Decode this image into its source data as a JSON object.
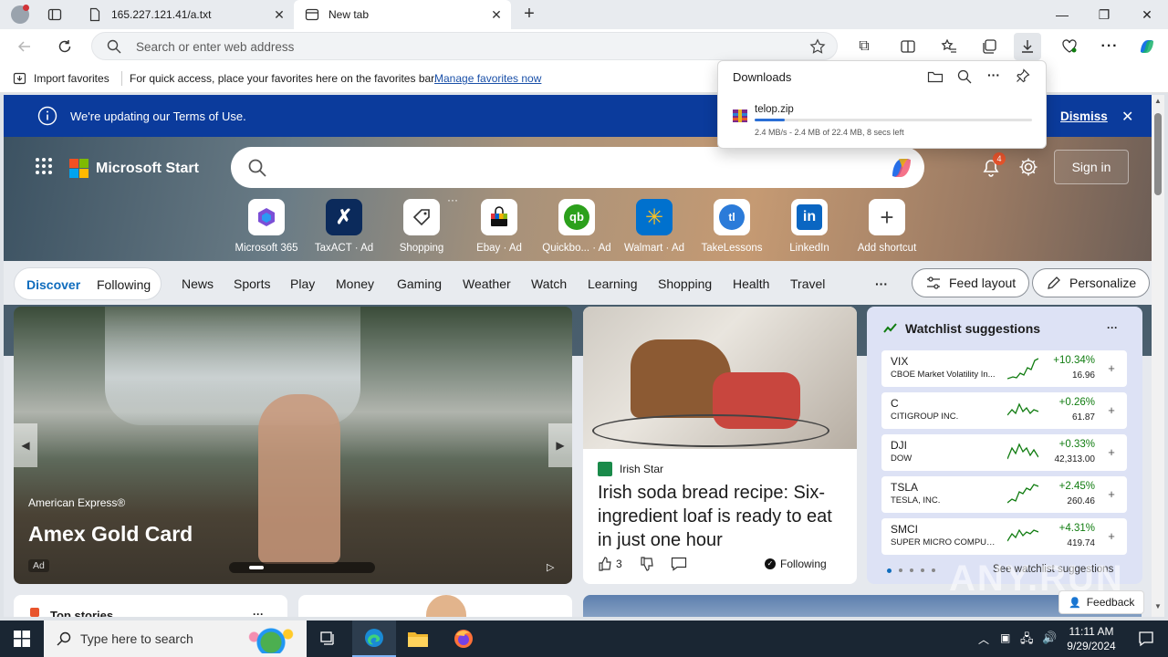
{
  "tabs": [
    {
      "label": "165.227.121.41/a.txt"
    },
    {
      "label": "New tab"
    }
  ],
  "omnibox": {
    "placeholder": "Search or enter web address"
  },
  "favbar": {
    "import_label": "Import favorites",
    "message": "For quick access, place your favorites here on the favorites bar.",
    "manage_link": "Manage favorites now"
  },
  "downloads": {
    "title": "Downloads",
    "file": "telop.zip",
    "status": "2.4 MB/s - 2.4 MB of 22.4 MB, 8 secs left",
    "progress": 0.107
  },
  "notice": {
    "text": "We're updating our Terms of Use.",
    "dismiss": "Dismiss"
  },
  "start": {
    "logo": "Microsoft Start",
    "notification_count": "4",
    "signin": "Sign in"
  },
  "shortcuts": [
    {
      "label": "Microsoft 365",
      "color": "#7b4fd6"
    },
    {
      "label": "TaxACT · Ad",
      "color": "#0b2a5b"
    },
    {
      "label": "Shopping",
      "color": "#444444"
    },
    {
      "label": "Ebay · Ad",
      "color": "#e53238"
    },
    {
      "label": "Quickbo... · Ad",
      "color": "#2ca01c"
    },
    {
      "label": "Walmart · Ad",
      "color": "#0071ce"
    },
    {
      "label": "TakeLessons",
      "color": "#2b7bd9"
    },
    {
      "label": "LinkedIn",
      "color": "#0a66c2"
    },
    {
      "label": "Add shortcut",
      "color": "#555555"
    }
  ],
  "feedtabs": {
    "discover": "Discover",
    "following": "Following",
    "items": [
      "News",
      "Sports",
      "Play",
      "Money",
      "Gaming",
      "Weather",
      "Watch",
      "Learning",
      "Shopping",
      "Health",
      "Travel"
    ],
    "more": "···",
    "feed_layout": "Feed layout",
    "personalize": "Personalize"
  },
  "ad": {
    "brand": "American Express®",
    "title": "Amex Gold Card",
    "tag": "Ad"
  },
  "news": {
    "source": "Irish Star",
    "headline": "Irish soda bread recipe: Six-ingredient loaf is ready to eat in just one hour",
    "likes": "3",
    "following": "Following"
  },
  "watchlist": {
    "title": "Watchlist suggestions",
    "see_all": "See watchlist suggestions",
    "rows": [
      {
        "symbol": "VIX",
        "name": "CBOE Market Volatility In...",
        "change": "+10.34%",
        "price": "16.96"
      },
      {
        "symbol": "C",
        "name": "CITIGROUP INC.",
        "change": "+0.26%",
        "price": "61.87"
      },
      {
        "symbol": "DJI",
        "name": "DOW",
        "change": "+0.33%",
        "price": "42,313.00"
      },
      {
        "symbol": "TSLA",
        "name": "TESLA, INC.",
        "change": "+2.45%",
        "price": "260.46"
      },
      {
        "symbol": "SMCI",
        "name": "SUPER MICRO COMPUTE...",
        "change": "+4.31%",
        "price": "419.74"
      }
    ]
  },
  "bottom": {
    "top_stories": "Top stories",
    "feedback": "Feedback"
  },
  "watermark": "ANY.RUN",
  "taskbar": {
    "search_placeholder": "Type here to search",
    "time": "11:11 AM",
    "date": "9/29/2024"
  }
}
